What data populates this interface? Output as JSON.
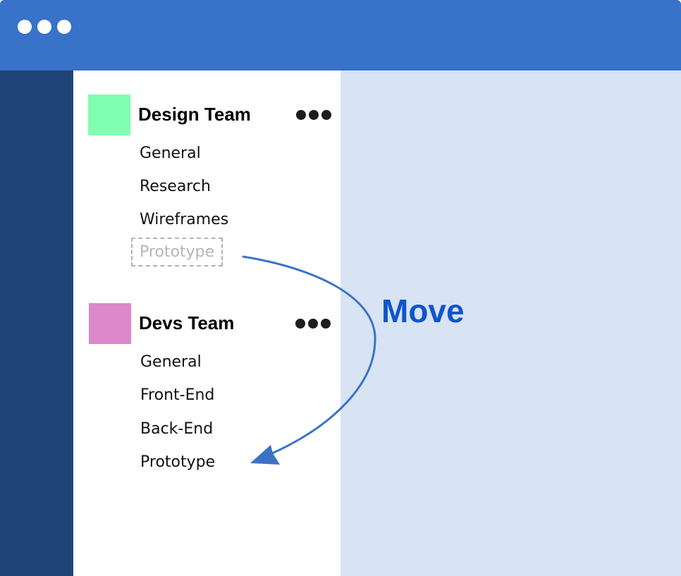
{
  "window": {
    "control_dots": 3
  },
  "teams": [
    {
      "name": "Design Team",
      "color": "#80ffb3",
      "channels": [
        "General",
        "Research",
        "Wireframes"
      ],
      "ghost_channel": "Prototype"
    },
    {
      "name": "Devs Team",
      "color": "#de88cc",
      "channels": [
        "General",
        "Front-End",
        "Back-End",
        "Prototype"
      ]
    }
  ],
  "annotation": {
    "label": "Move",
    "color": "#0f55cc",
    "arrow_color": "#3a73c6"
  },
  "icons": {
    "window_controls": "window-dots-icon",
    "team_menu": "more-horizontal-icon"
  },
  "colors": {
    "titlebar": "#3872c9",
    "rail": "#1f4577",
    "main": "#d8e3f4"
  }
}
